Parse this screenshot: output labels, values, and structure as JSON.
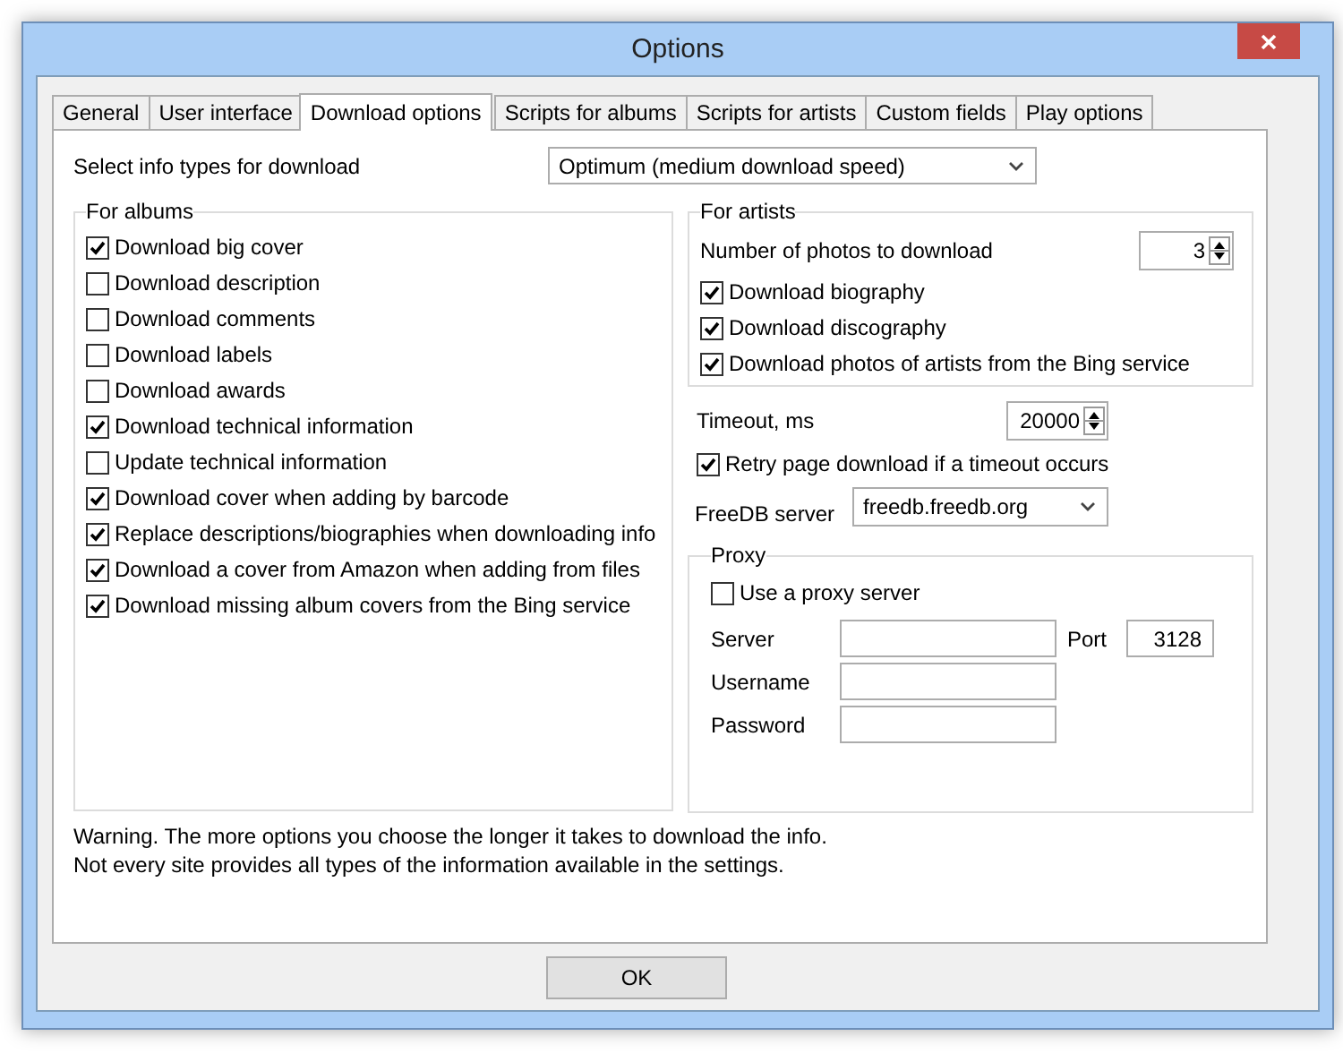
{
  "window": {
    "title": "Options"
  },
  "tabs": [
    {
      "label": "General",
      "selected": false
    },
    {
      "label": "User interface",
      "selected": false
    },
    {
      "label": "Download options",
      "selected": true
    },
    {
      "label": "Scripts for albums",
      "selected": false
    },
    {
      "label": "Scripts for artists",
      "selected": false
    },
    {
      "label": "Custom fields",
      "selected": false
    },
    {
      "label": "Play options",
      "selected": false
    }
  ],
  "info_types": {
    "label": "Select info types for download",
    "value": "Optimum (medium download speed)"
  },
  "for_albums": {
    "title": "For albums",
    "options": [
      {
        "label": "Download big cover",
        "checked": true
      },
      {
        "label": "Download description",
        "checked": false
      },
      {
        "label": "Download comments",
        "checked": false
      },
      {
        "label": "Download labels",
        "checked": false
      },
      {
        "label": "Download awards",
        "checked": false
      },
      {
        "label": "Download technical information",
        "checked": true
      },
      {
        "label": "Update technical information",
        "checked": false
      },
      {
        "label": "Download cover when adding by barcode",
        "checked": true
      },
      {
        "label": "Replace descriptions/biographies when downloading info",
        "checked": true
      },
      {
        "label": "Download a cover from Amazon when adding from files",
        "checked": true
      },
      {
        "label": "Download missing album covers from the Bing service",
        "checked": true
      }
    ]
  },
  "for_artists": {
    "title": "For artists",
    "photos_label": "Number of photos to download",
    "photos_value": "3",
    "options": [
      {
        "label": "Download biography",
        "checked": true
      },
      {
        "label": "Download discography",
        "checked": true
      },
      {
        "label": "Download photos of artists from the Bing service",
        "checked": true
      }
    ]
  },
  "timeout": {
    "label": "Timeout, ms",
    "value": "20000"
  },
  "retry": {
    "label": "Retry page download if a timeout occurs",
    "checked": true
  },
  "freedb": {
    "label": "FreeDB server",
    "value": "freedb.freedb.org"
  },
  "proxy": {
    "title": "Proxy",
    "use": {
      "label": "Use a proxy server",
      "checked": false
    },
    "fields": [
      {
        "label": "Server"
      },
      {
        "label": "Username"
      },
      {
        "label": "Password"
      }
    ],
    "port": {
      "label": "Port",
      "value": "3128"
    }
  },
  "warning": [
    "Warning. The more options you choose the longer it takes to download the info.",
    "Not every site provides all types of the information available in the settings."
  ],
  "buttons": [
    "OK"
  ]
}
